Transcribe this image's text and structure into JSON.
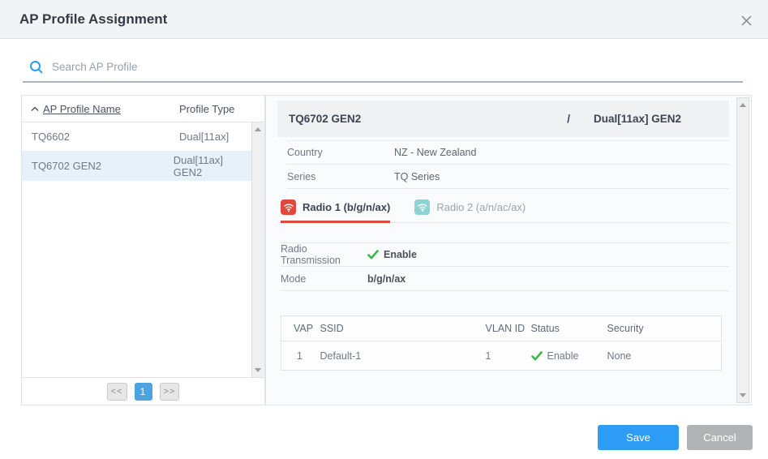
{
  "dialog": {
    "title": "AP Profile Assignment"
  },
  "search": {
    "placeholder": "Search AP Profile"
  },
  "profile_list": {
    "columns": {
      "name": "AP Profile Name",
      "type": "Profile Type"
    },
    "rows": [
      {
        "name": "TQ6602",
        "type": "Dual[11ax]"
      },
      {
        "name": "TQ6702 GEN2",
        "type": "Dual[11ax] GEN2"
      }
    ],
    "pagination": {
      "prev": "<<",
      "page": "1",
      "next": ">>"
    }
  },
  "detail": {
    "profile_name": "TQ6702 GEN2",
    "separator": "/",
    "profile_type": "Dual[11ax] GEN2",
    "fields": [
      {
        "label": "Country",
        "value": "NZ - New Zealand"
      },
      {
        "label": "Series",
        "value": "TQ Series"
      }
    ],
    "tabs": [
      {
        "label": "Radio 1 (b/g/n/ax)"
      },
      {
        "label": "Radio 2 (a/n/ac/ax)"
      }
    ],
    "radio": {
      "transmission_label": "Radio Transmission",
      "transmission_value": "Enable",
      "mode_label": "Mode",
      "mode_value": "b/g/n/ax"
    },
    "vap_table": {
      "headers": {
        "vap": "VAP",
        "ssid": "SSID",
        "vlan": "VLAN ID",
        "status": "Status",
        "security": "Security"
      },
      "rows": [
        {
          "vap": "1",
          "ssid": "Default-1",
          "vlan": "1",
          "status": "Enable",
          "security": "None"
        }
      ]
    }
  },
  "footer": {
    "save": "Save",
    "cancel": "Cancel"
  },
  "colors": {
    "accent_blue": "#2d9cf4",
    "page_active_blue": "#4ba4e0",
    "radio1_red": "#e2493d",
    "radio2_teal": "#8ed2d4",
    "status_green": "#3db54a",
    "selected_row_bg": "#e7f1fa",
    "cancel_gray": "#b1b3b5"
  }
}
